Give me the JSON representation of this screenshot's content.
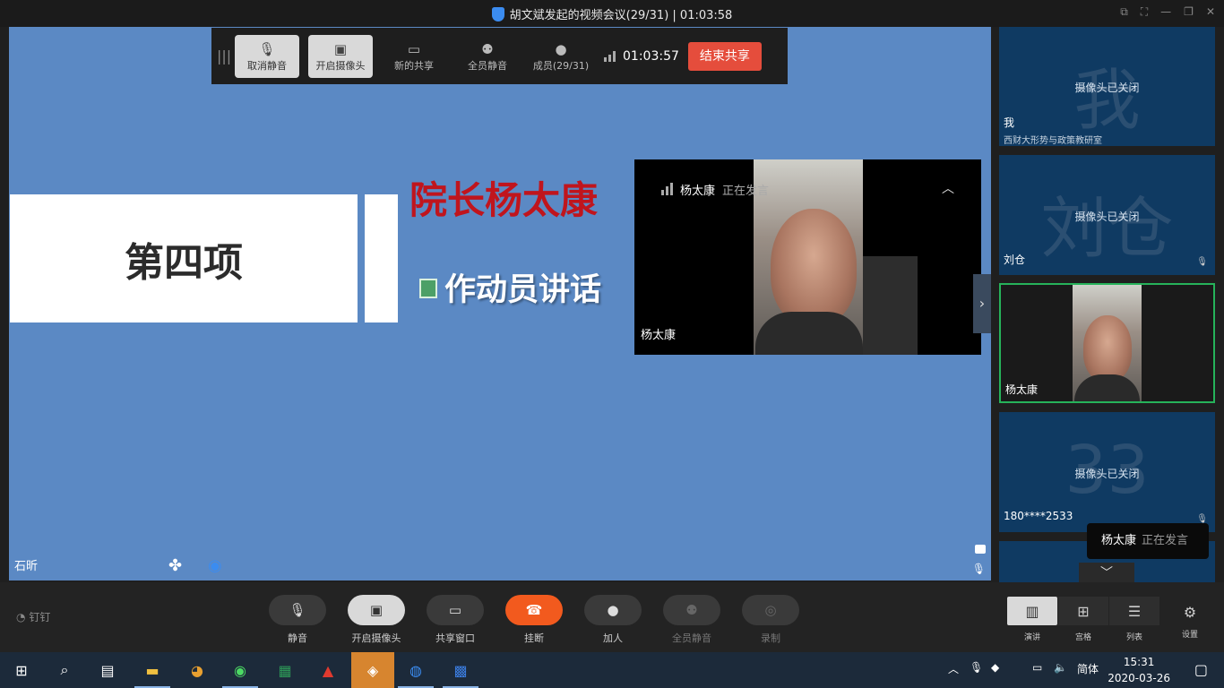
{
  "window": {
    "title": "胡文斌发起的视频会议(29/31) | 01:03:58"
  },
  "share_toolbar": {
    "unmute": "取消静音",
    "start_camera": "开启摄像头",
    "new_share": "新的共享",
    "mute_all": "全员静音",
    "members": "成员(29/31)",
    "timer": "01:03:57",
    "end_share": "结束共享"
  },
  "slide": {
    "section": "第四项",
    "presenter": "院长杨太康",
    "topic": "作动员讲话"
  },
  "speaker_video": {
    "name": "杨太康",
    "status": "正在发言",
    "label": "杨太康"
  },
  "main_view": {
    "participant_label": "石昕"
  },
  "participants": [
    {
      "avatar_text": "我",
      "camera_status": "摄像头已关闭",
      "name": "我",
      "sub": "西财大形势与政策教研室"
    },
    {
      "avatar_text": "刘仓",
      "camera_status": "摄像头已关闭",
      "name": "刘仓"
    },
    {
      "name": "杨太康"
    },
    {
      "avatar_text": "33",
      "camera_status": "摄像头已关闭",
      "name": "180****2533"
    }
  ],
  "speaking_toast": {
    "name": "杨太康",
    "status": "正在发言"
  },
  "bottom_bar": {
    "app_name": "钉钉",
    "mute": "静音",
    "start_camera": "开启摄像头",
    "share_window": "共享窗口",
    "hang_up": "挂断",
    "add_person": "加人",
    "mute_all": "全员静音",
    "record": "录制",
    "views": {
      "speaker": "演讲",
      "grid": "宫格",
      "list": "列表"
    },
    "settings": "设置"
  },
  "taskbar": {
    "ime": "简体",
    "time": "15:31",
    "date": "2020-03-26"
  },
  "colors": {
    "end_red": "#e54d3c",
    "hangup_orange": "#f25a1e",
    "slide_bg": "#5b89c4",
    "active_border": "#26b35a",
    "tile_bg": "#0f3a62"
  }
}
